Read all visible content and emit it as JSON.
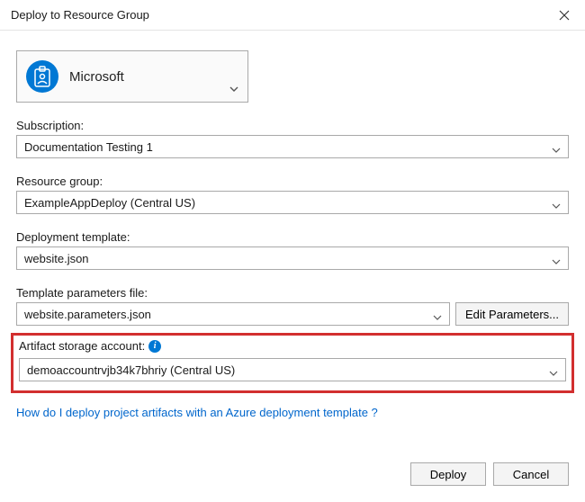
{
  "window": {
    "title": "Deploy to Resource Group"
  },
  "account": {
    "name": "Microsoft"
  },
  "fields": {
    "subscription": {
      "label": "Subscription:",
      "value": "Documentation Testing 1"
    },
    "resource_group": {
      "label": "Resource group:",
      "value": "ExampleAppDeploy (Central US)"
    },
    "deployment_template": {
      "label": "Deployment template:",
      "value": "website.json"
    },
    "template_params": {
      "label": "Template parameters file:",
      "value": "website.parameters.json",
      "edit_button": "Edit Parameters..."
    },
    "artifact_storage": {
      "label": "Artifact storage account:",
      "value": "demoaccountrvjb34k7bhriy (Central US)"
    }
  },
  "help_link": "How do I deploy project artifacts with an Azure deployment template ?",
  "buttons": {
    "deploy": "Deploy",
    "cancel": "Cancel"
  }
}
